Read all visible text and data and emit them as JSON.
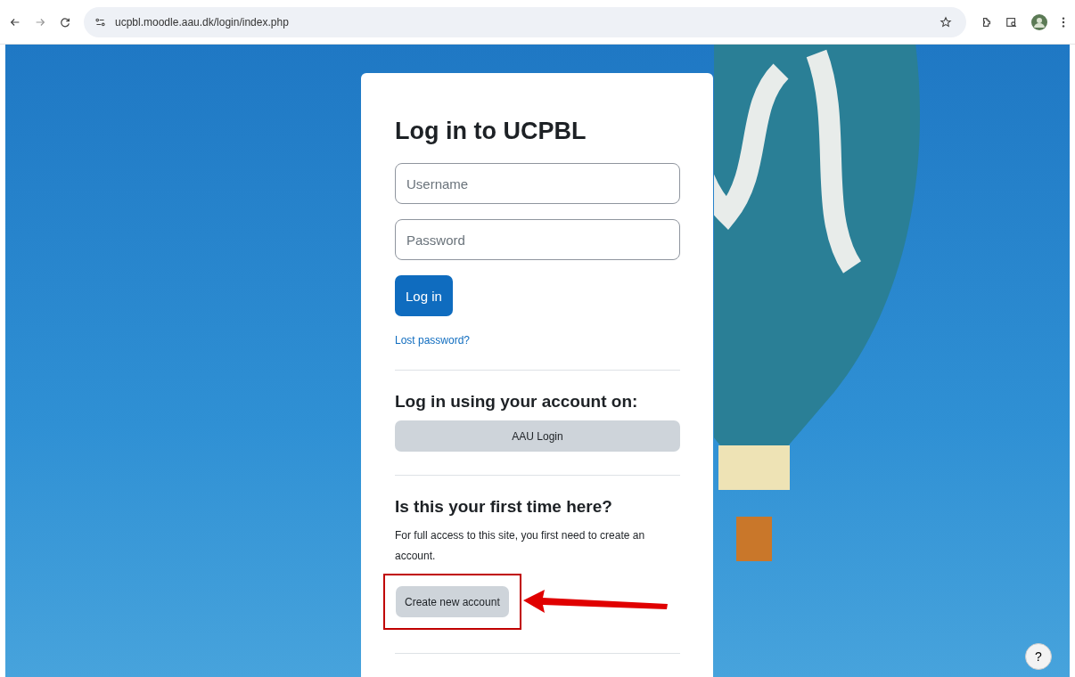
{
  "browser": {
    "url": "ucpbl.moodle.aau.dk/login/index.php"
  },
  "login_card": {
    "title": "Log in to UCPBL",
    "username": {
      "placeholder": "Username"
    },
    "password": {
      "placeholder": "Password"
    },
    "login_button": "Log in",
    "lost_password_link": "Lost password?",
    "external_login": {
      "heading": "Log in using your account on:",
      "button": "AAU Login"
    },
    "signup": {
      "heading": "Is this your first time here?",
      "text": "For full access to this site, you first need to create an account.",
      "button": "Create new account",
      "highlighted": true
    }
  },
  "help_button": "?"
}
